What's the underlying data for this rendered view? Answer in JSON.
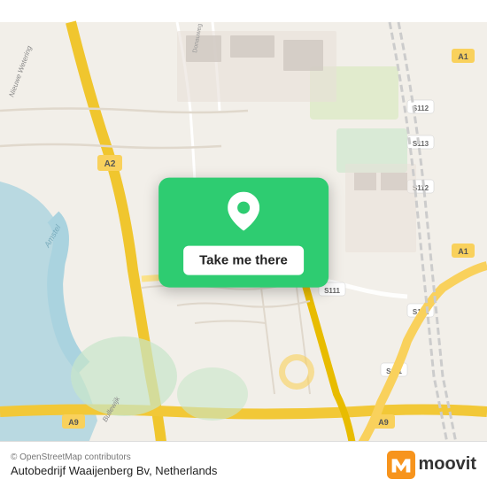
{
  "map": {
    "alt": "Map of Amsterdam area, Netherlands",
    "popup": {
      "button_label": "Take me there"
    },
    "pin_color": "#fff",
    "card_color": "#2ecc71"
  },
  "bottom_bar": {
    "copyright": "© OpenStreetMap contributors",
    "place_name": "Autobedrijf Waaijenberg Bv, Netherlands",
    "logo_text": "moovit"
  }
}
